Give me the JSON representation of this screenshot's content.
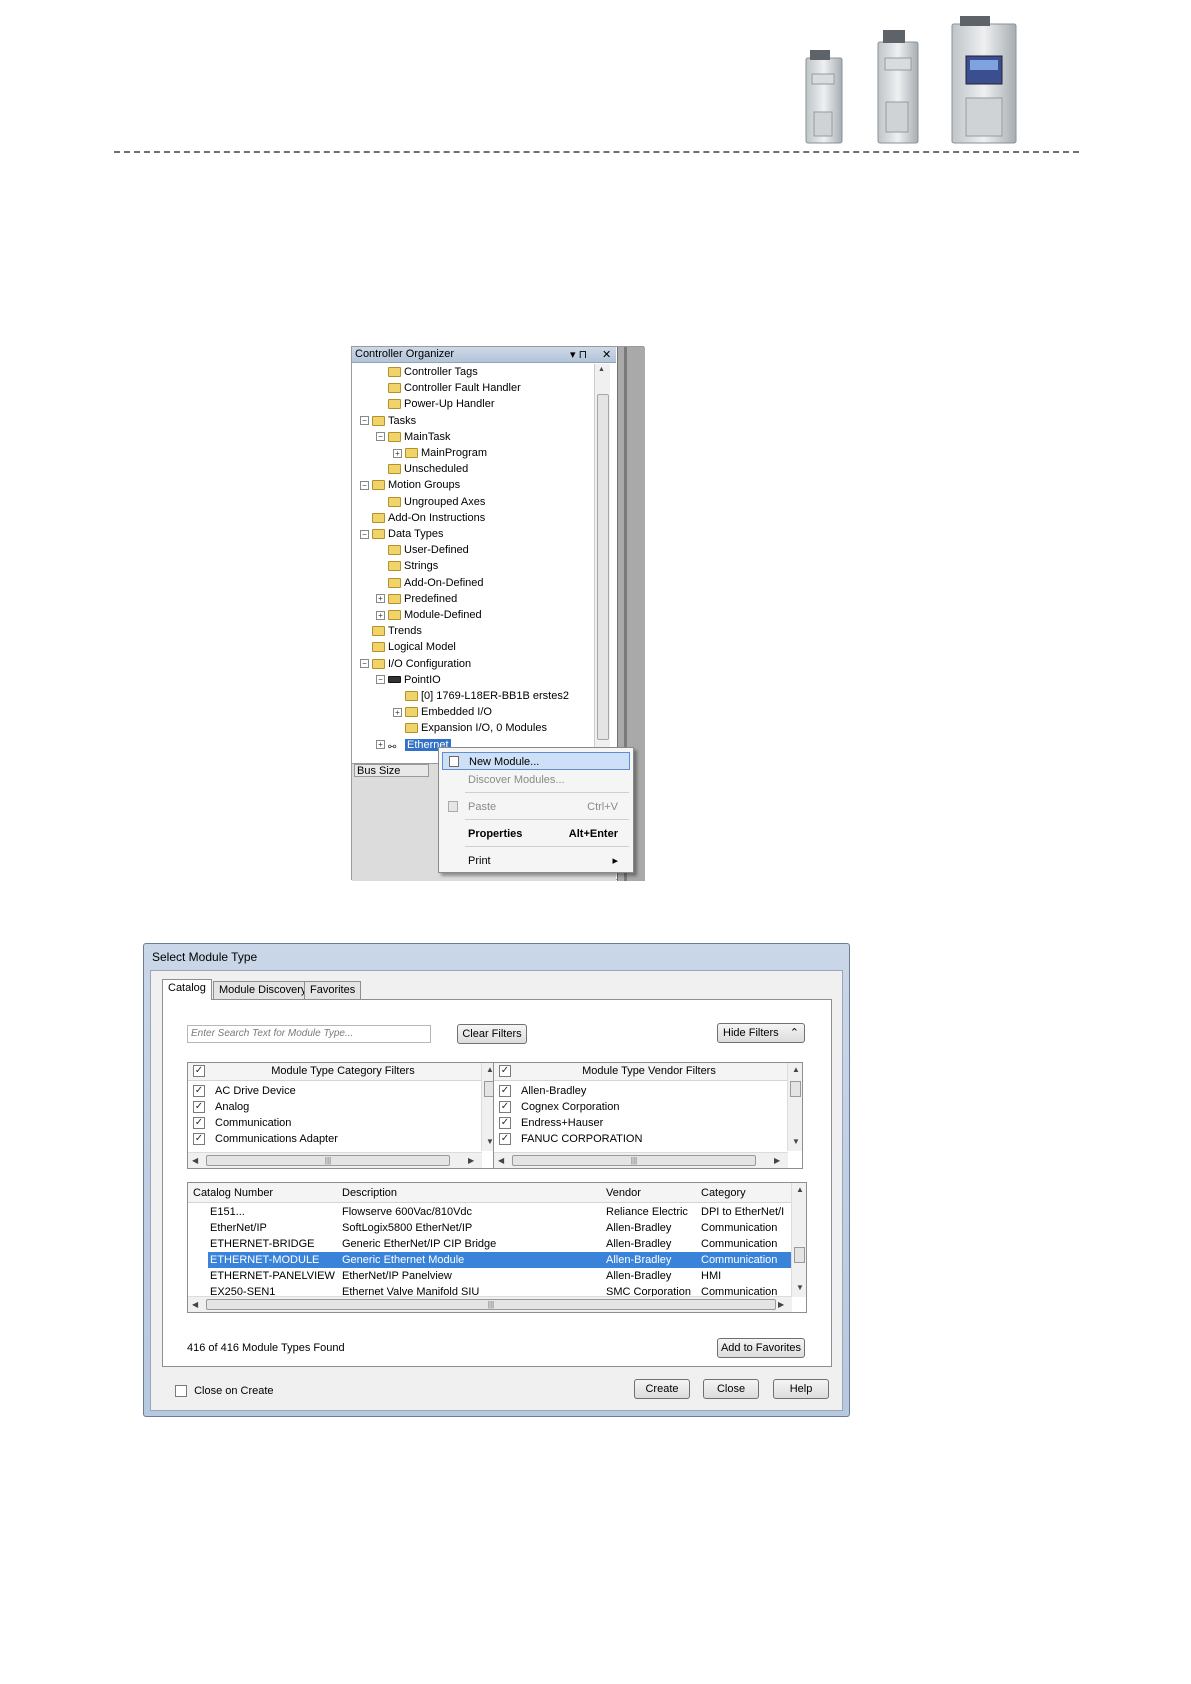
{
  "organizer": {
    "title": "Controller Organizer",
    "pin_glyph": "▾ ⊓",
    "close_glyph": "✕",
    "tree": [
      {
        "label": "Controller Tags",
        "depth": 2
      },
      {
        "label": "Controller Fault Handler",
        "depth": 2
      },
      {
        "label": "Power-Up Handler",
        "depth": 2
      },
      {
        "label": "Tasks",
        "depth": 1
      },
      {
        "label": "MainTask",
        "depth": 2
      },
      {
        "label": "MainProgram",
        "depth": 3
      },
      {
        "label": "Unscheduled",
        "depth": 2
      },
      {
        "label": "Motion Groups",
        "depth": 1
      },
      {
        "label": "Ungrouped Axes",
        "depth": 2
      },
      {
        "label": "Add-On Instructions",
        "depth": 1
      },
      {
        "label": "Data Types",
        "depth": 1
      },
      {
        "label": "User-Defined",
        "depth": 2
      },
      {
        "label": "Strings",
        "depth": 2
      },
      {
        "label": "Add-On-Defined",
        "depth": 2
      },
      {
        "label": "Predefined",
        "depth": 2
      },
      {
        "label": "Module-Defined",
        "depth": 2
      },
      {
        "label": "Trends",
        "depth": 1
      },
      {
        "label": "Logical Model",
        "depth": 1
      },
      {
        "label": "I/O Configuration",
        "depth": 1
      },
      {
        "label": "PointIO",
        "depth": 2
      },
      {
        "label": "[0] 1769-L18ER-BB1B erstes2",
        "depth": 3
      },
      {
        "label": "Embedded I/O",
        "depth": 3
      },
      {
        "label": "Expansion I/O, 0 Modules",
        "depth": 3
      },
      {
        "label": "Ethernet",
        "depth": 2
      }
    ],
    "bus_size_label": "Bus Size"
  },
  "context_menu": {
    "items": [
      {
        "label": "New Module...",
        "shortcut": ""
      },
      {
        "label": "Discover Modules...",
        "shortcut": ""
      },
      {
        "label": "Paste",
        "shortcut": "Ctrl+V"
      },
      {
        "label": "Properties",
        "shortcut": "Alt+Enter"
      },
      {
        "label": "Print",
        "shortcut": "▸"
      }
    ]
  },
  "dialog": {
    "title": "Select Module Type",
    "tabs": [
      "Catalog",
      "Module Discovery",
      "Favorites"
    ],
    "search_placeholder": "Enter Search Text for Module Type...",
    "clear_filters": "Clear Filters",
    "hide_filters": "Hide Filters",
    "hide_filters_glyph": "⌃",
    "category_filter": {
      "title": "Module Type Category Filters",
      "items": [
        "AC Drive Device",
        "Analog",
        "Communication",
        "Communications Adapter"
      ]
    },
    "vendor_filter": {
      "title": "Module Type Vendor Filters",
      "items": [
        "Allen-Bradley",
        "Cognex Corporation",
        "Endress+Hauser",
        "FANUC CORPORATION"
      ]
    },
    "columns": [
      "Catalog Number",
      "Description",
      "Vendor",
      "Category"
    ],
    "rows": [
      [
        "E151...",
        "Flowserve 600Vac/810Vdc",
        "Reliance Electric",
        "DPI to EtherNet/I"
      ],
      [
        "EtherNet/IP",
        "SoftLogix5800 EtherNet/IP",
        "Allen-Bradley",
        "Communication"
      ],
      [
        "ETHERNET-BRIDGE",
        "Generic EtherNet/IP CIP Bridge",
        "Allen-Bradley",
        "Communication"
      ],
      [
        "ETHERNET-MODULE",
        "Generic Ethernet Module",
        "Allen-Bradley",
        "Communication"
      ],
      [
        "ETHERNET-PANELVIEW",
        "EtherNet/IP Panelview",
        "Allen-Bradley",
        "HMI"
      ],
      [
        "EX250-SEN1",
        "Ethernet Valve Manifold SIU",
        "SMC Corporation",
        "Communication"
      ]
    ],
    "selected_row": 3,
    "found_text": "416 of 416 Module Types Found",
    "add_to_favorites": "Add to Favorites",
    "close_on_create": "Close on Create",
    "create": "Create",
    "close": "Close",
    "help": "Help"
  }
}
